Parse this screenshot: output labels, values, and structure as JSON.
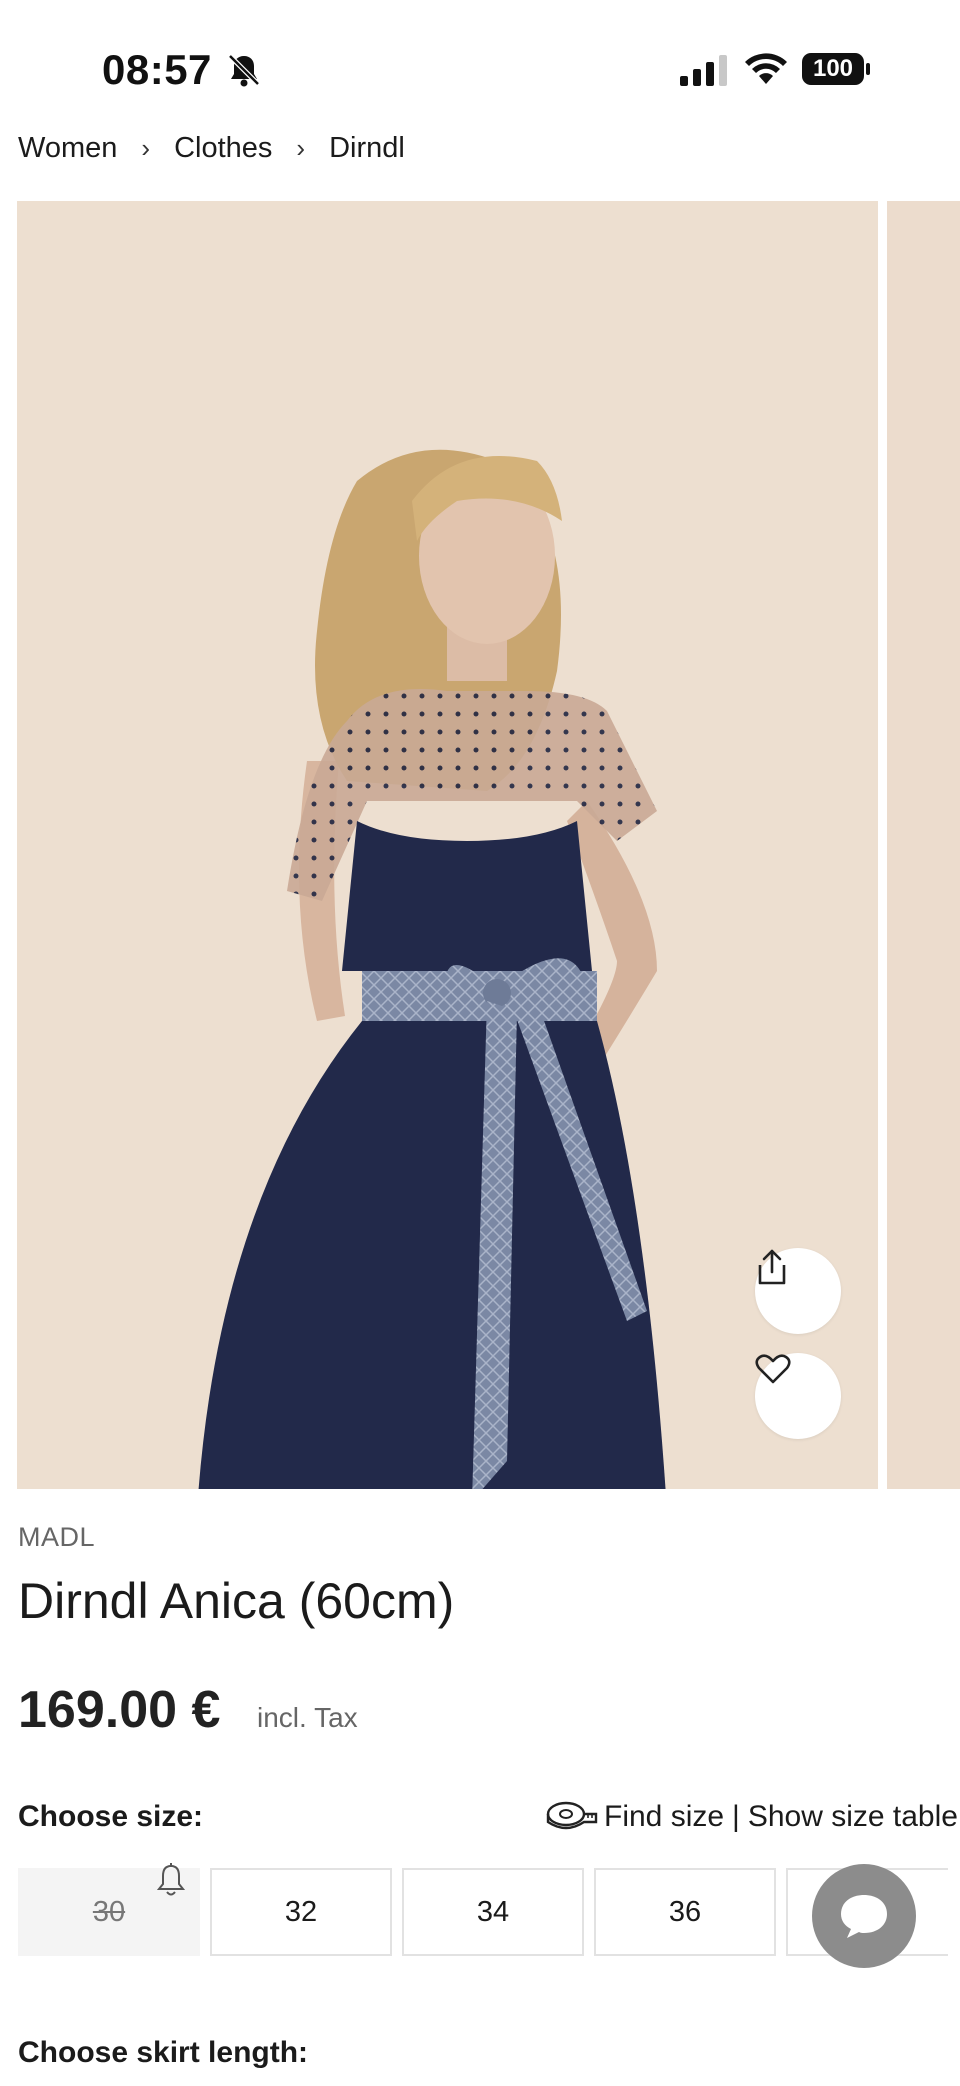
{
  "status_bar": {
    "time": "08:57",
    "battery": "100"
  },
  "breadcrumb": {
    "items": [
      "Women",
      "Clothes",
      "Dirndl"
    ],
    "separator": "›"
  },
  "gallery": {
    "background": "#eddfd0",
    "dress_color": "#22294a",
    "apron_pattern_color": "#8d9ab4"
  },
  "product": {
    "brand": "MADL",
    "title": "Dirndl Anica (60cm)",
    "price": "169.00 €",
    "tax_note": "incl. Tax"
  },
  "size_section": {
    "label": "Choose size:",
    "find_size": "Find size",
    "divider": "|",
    "size_table": "Show size table",
    "sizes": [
      {
        "label": "30",
        "available": false
      },
      {
        "label": "32",
        "available": true
      },
      {
        "label": "34",
        "available": true
      },
      {
        "label": "36",
        "available": true
      },
      {
        "label": "",
        "available": true
      }
    ]
  },
  "skirt_section": {
    "label": "Choose skirt length:"
  },
  "icons": {
    "share": "share-icon",
    "wishlist": "heart-icon",
    "chat": "chat-bubble-icon",
    "tape": "measuring-tape-icon",
    "notify": "bell-icon"
  }
}
